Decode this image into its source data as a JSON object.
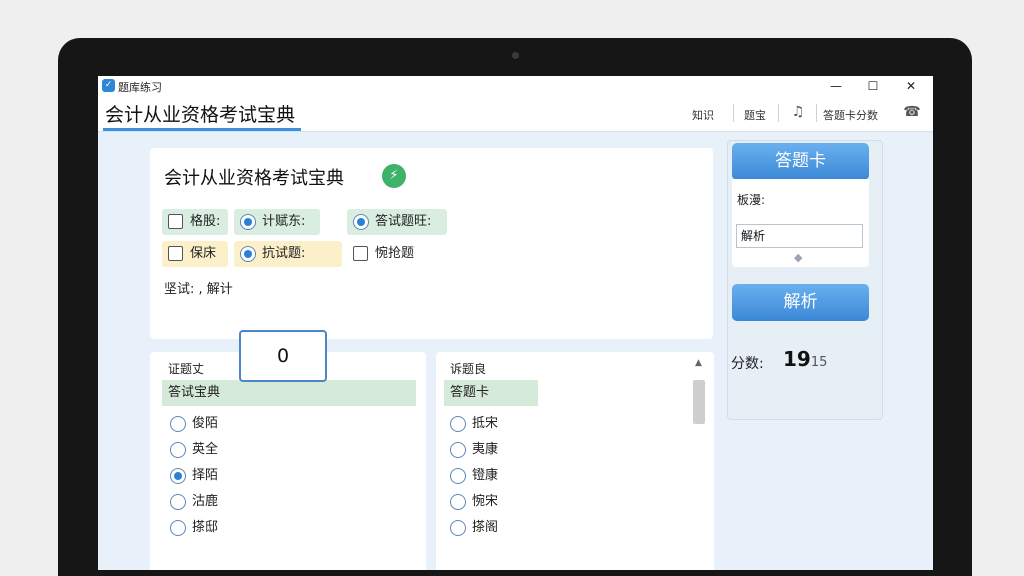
{
  "window": {
    "title": "题库练习",
    "minimize": "—",
    "maximize": "☐",
    "close": "✕"
  },
  "header": {
    "app_title": "会计从业资格考试宝典",
    "nav": [
      "知识",
      "题宝",
      "答题卡分数"
    ]
  },
  "main": {
    "title": "会计从业资格考试宝典",
    "options": [
      {
        "label": "格股:",
        "type": "checkbox",
        "checked": false
      },
      {
        "label": "计赋东:",
        "type": "radio",
        "checked": true
      },
      {
        "label": "答试题旺:",
        "type": "radio",
        "checked": true
      },
      {
        "label": "保床",
        "type": "checkbox",
        "checked": false
      },
      {
        "label": "抗试题:",
        "type": "radio",
        "checked": true
      },
      {
        "label": "惋抢题",
        "type": "checkbox",
        "checked": false
      }
    ],
    "note": "坚试: , 解计",
    "number_box": "0"
  },
  "left_list": {
    "header": "证题丈",
    "highlighted": "答试宝典",
    "items": [
      {
        "label": "俊陌",
        "checked": false
      },
      {
        "label": "英全",
        "checked": false
      },
      {
        "label": "择陌",
        "checked": true
      },
      {
        "label": "沽鹿",
        "checked": false
      },
      {
        "label": "搽邸",
        "checked": false
      }
    ]
  },
  "right_list": {
    "header": "诉题良",
    "highlighted": "答题卡",
    "items": [
      {
        "label": "抵宋",
        "checked": false
      },
      {
        "label": "夷康",
        "checked": false
      },
      {
        "label": "镫康",
        "checked": false
      },
      {
        "label": "惋宋",
        "checked": false
      },
      {
        "label": "搽阁",
        "checked": false
      }
    ]
  },
  "side": {
    "answer_card_button": "答题卡",
    "field_label": "板漫:",
    "field_value": "解析",
    "analysis_button": "解析",
    "score_label": "分数:",
    "score_value": "19",
    "score_suffix": "15"
  }
}
